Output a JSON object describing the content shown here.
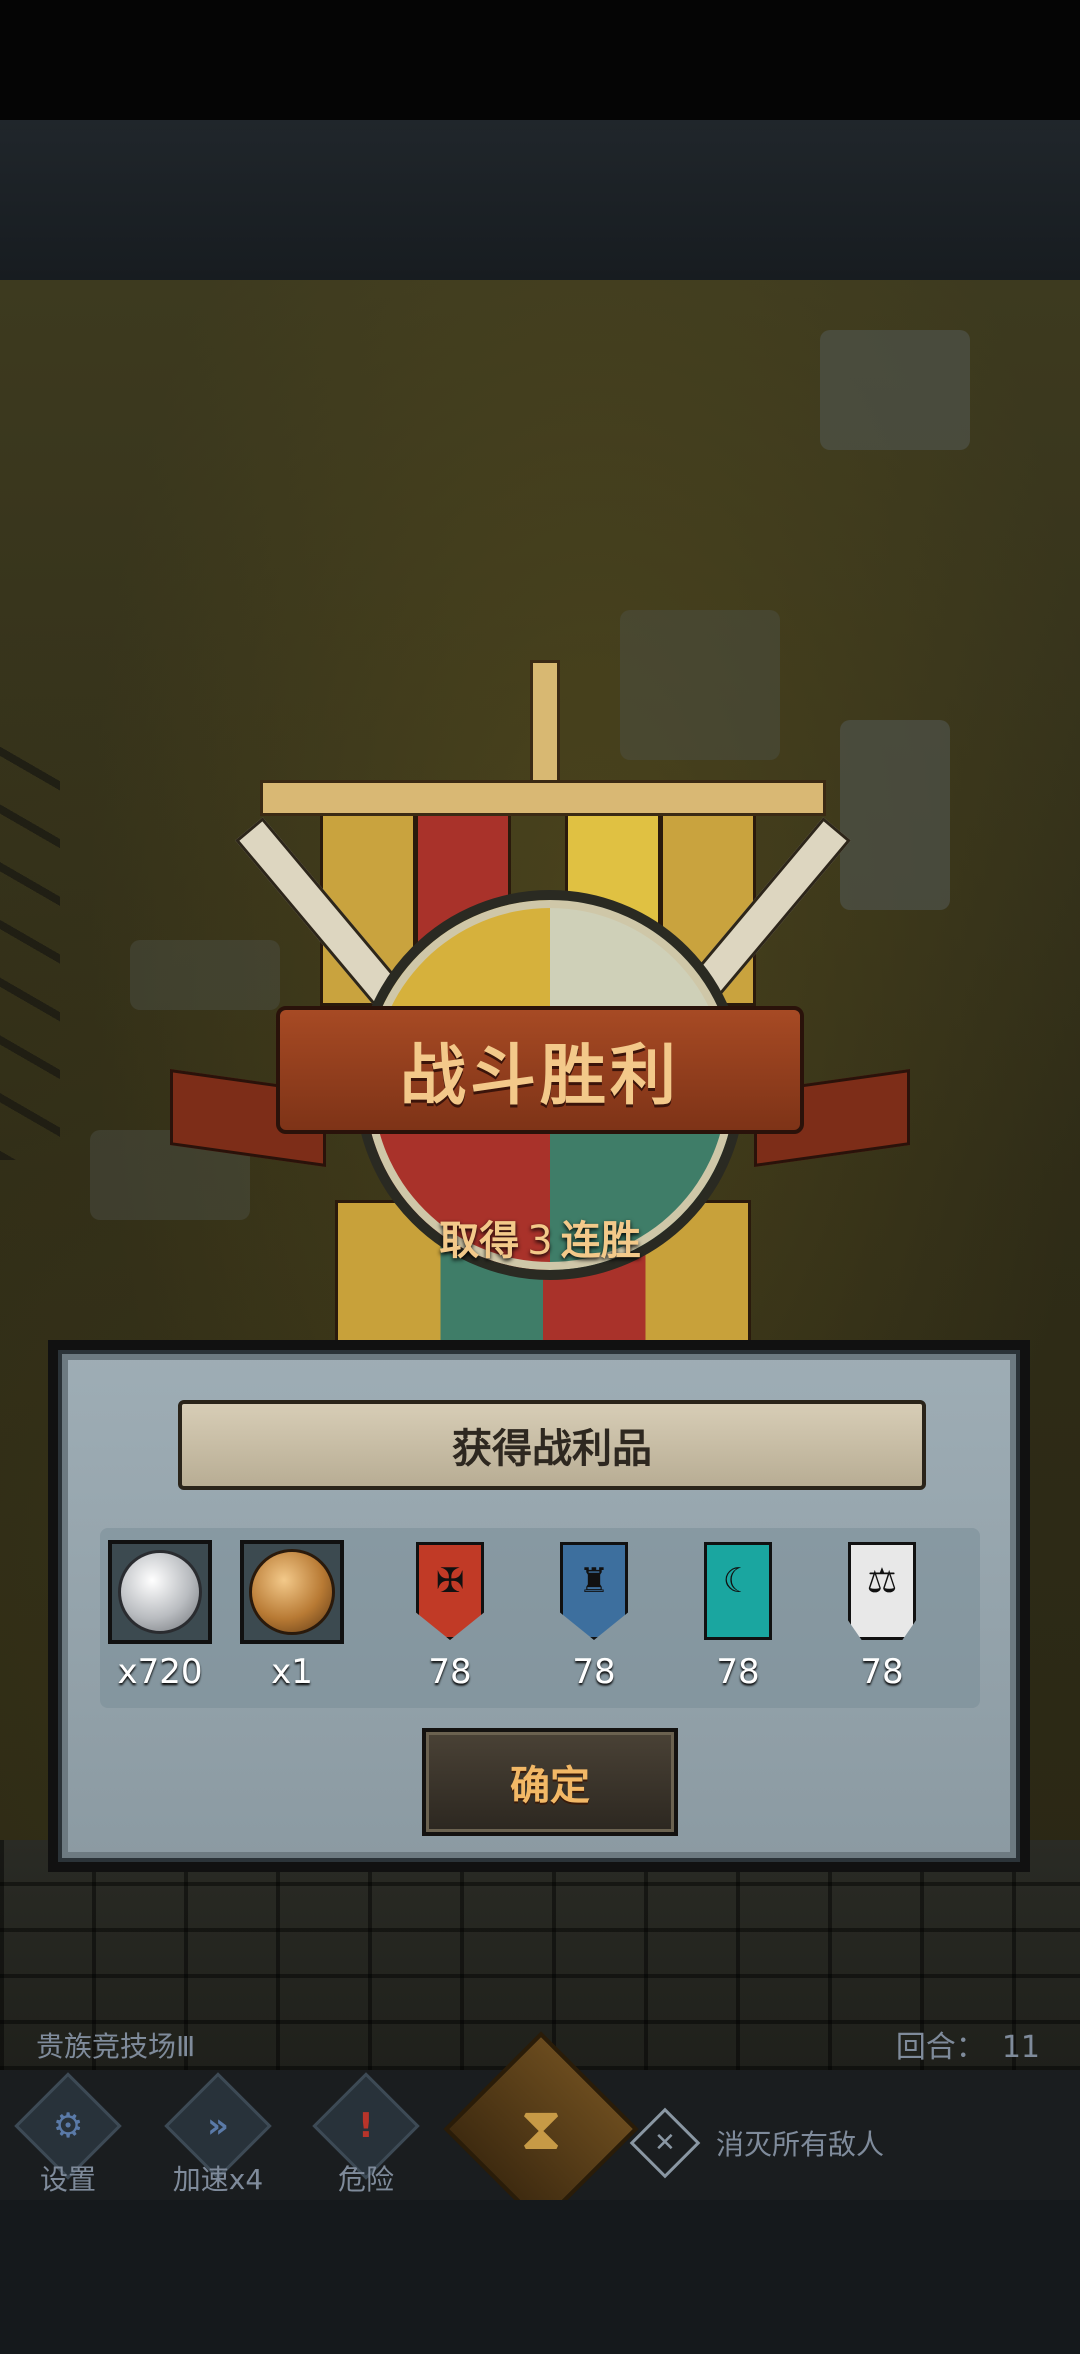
{
  "victory": {
    "title": "战斗胜利",
    "streak_prefix": "取得",
    "streak_count": "3",
    "streak_suffix": "连胜"
  },
  "loot_panel": {
    "title": "获得战利品",
    "items": [
      {
        "icon": "silver-coin-icon",
        "count": "x720"
      },
      {
        "icon": "bronze-helmet-icon",
        "count": "x1"
      },
      {
        "icon": "red-crest-icon",
        "count": "78"
      },
      {
        "icon": "blue-crest-icon",
        "count": "78"
      },
      {
        "icon": "teal-crest-icon",
        "count": "78"
      },
      {
        "icon": "white-crest-icon",
        "count": "78"
      }
    ],
    "confirm_label": "确定"
  },
  "hud": {
    "arena_name": "贵族竞技场Ⅲ",
    "round_label": "回合：",
    "round_value": "11",
    "buttons": [
      {
        "icon": "gear-icon",
        "label": "设置"
      },
      {
        "icon": "fast-forward-icon",
        "label": "加速x4"
      },
      {
        "icon": "danger-icon",
        "label": "危险"
      }
    ],
    "objective": "消灭所有敌人"
  },
  "colors": {
    "title_gold": "#f3c98a",
    "confirm_text": "#f2b866",
    "hud_text": "#7f8b9b"
  }
}
